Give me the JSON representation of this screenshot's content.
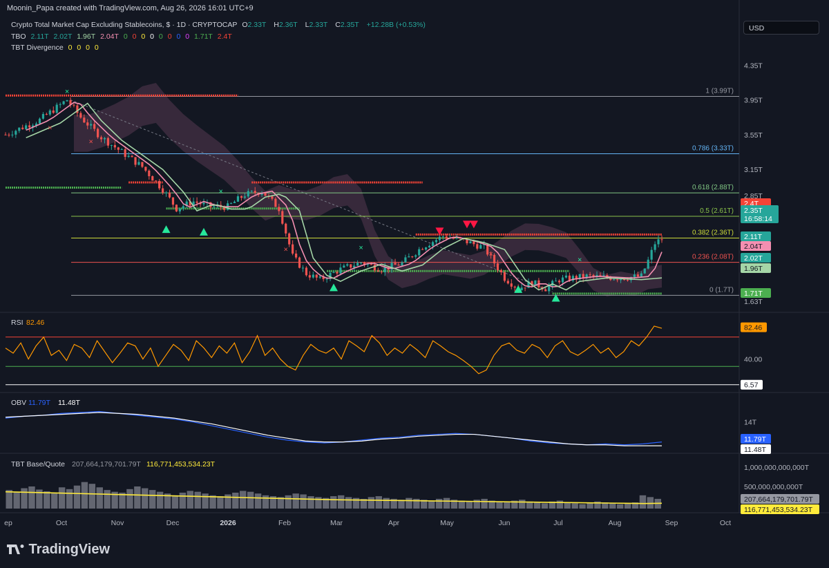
{
  "header": {
    "credit": "Moonin_Papa created with TradingView.com, Aug 26, 2026 16:01 UTC+9"
  },
  "symbol": {
    "title": "Crypto Total Market Cap Excluding Stablecoins, $ · 1D · CRYPTOCAP",
    "o_label": "O",
    "o": "2.33T",
    "h_label": "H",
    "h": "2.36T",
    "l_label": "L",
    "l": "2.33T",
    "c_label": "C",
    "c": "2.35T",
    "change": "+12.28B (+0.53%)"
  },
  "tbo_legend": {
    "label": "TBO",
    "values": [
      "2.11T",
      "2.02T",
      "1.96T",
      "2.04T",
      "0",
      "0",
      "0",
      "0",
      "0",
      "0",
      "0",
      "0",
      "1.71T",
      "2.4T"
    ]
  },
  "div_legend": {
    "label": "TBT Divergence",
    "values": [
      "0",
      "0",
      "0",
      "0"
    ]
  },
  "currency": "USD",
  "colors": {
    "bg": "#131722",
    "up": "#26a69a",
    "down": "#ef5350",
    "pink": "#f48fb1",
    "mint": "#a5d6a7",
    "rsi": "#ff9800",
    "obv": "#2962ff",
    "yellow": "#ffeb3b",
    "green_level": "#4caf50",
    "red_level": "#f44336"
  },
  "chart_data": [
    {
      "type": "candlestick",
      "title": "Crypto Total Market Cap Excluding Stablecoins",
      "x_ticks": [
        "ep",
        "Oct",
        "Nov",
        "Dec",
        "2026",
        "Feb",
        "Mar",
        "Apr",
        "May",
        "Jun",
        "Jul",
        "Aug",
        "Sep",
        "Oct"
      ],
      "y_ticks": [
        "4.35T",
        "3.95T",
        "3.55T",
        "3.15T",
        "2.85T",
        "2.65T",
        "1.75T",
        "1.63T"
      ],
      "ylim": [
        1.6,
        4.4
      ],
      "series_path": [
        [
          0,
          3.55
        ],
        [
          10,
          3.72
        ],
        [
          18,
          3.95
        ],
        [
          22,
          3.75
        ],
        [
          28,
          3.52
        ],
        [
          34,
          3.35
        ],
        [
          40,
          3.18
        ],
        [
          46,
          2.92
        ],
        [
          50,
          2.7
        ],
        [
          55,
          2.78
        ],
        [
          60,
          2.72
        ],
        [
          65,
          2.72
        ],
        [
          70,
          2.86
        ],
        [
          75,
          2.9
        ],
        [
          80,
          2.7
        ],
        [
          84,
          2.15
        ],
        [
          88,
          1.95
        ],
        [
          92,
          1.88
        ],
        [
          98,
          2.0
        ],
        [
          104,
          2.08
        ],
        [
          110,
          2.0
        ],
        [
          116,
          2.07
        ],
        [
          122,
          2.26
        ],
        [
          128,
          2.38
        ],
        [
          134,
          2.33
        ],
        [
          140,
          2.25
        ],
        [
          146,
          1.9
        ],
        [
          150,
          1.78
        ],
        [
          154,
          1.85
        ],
        [
          158,
          1.78
        ],
        [
          162,
          1.88
        ],
        [
          170,
          1.92
        ],
        [
          180,
          1.9
        ],
        [
          186,
          1.92
        ],
        [
          188,
          2.1
        ],
        [
          190,
          2.3
        ],
        [
          192,
          2.35
        ]
      ],
      "fib_levels": [
        {
          "label": "1 (3.99T)",
          "value": 3.99,
          "color": "#9598a1"
        },
        {
          "label": "0.786 (3.33T)",
          "value": 3.33,
          "color": "#64b5f6"
        },
        {
          "label": "0.618 (2.88T)",
          "value": 2.88,
          "color": "#81c784"
        },
        {
          "label": "0.5 (2.61T)",
          "value": 2.61,
          "color": "#8bc34a"
        },
        {
          "label": "0.382 (2.36T)",
          "value": 2.36,
          "color": "#cddc39"
        },
        {
          "label": "0.236 (2.08T)",
          "value": 2.08,
          "color": "#ef5350"
        },
        {
          "label": "0 (1.7T)",
          "value": 1.7,
          "color": "#9598a1"
        }
      ],
      "support_levels": [
        {
          "value": 2.94,
          "from": 0,
          "to": 34,
          "color": "#4caf50"
        },
        {
          "value": 2.7,
          "from": 47,
          "to": 86,
          "color": "#4caf50"
        },
        {
          "value": 1.98,
          "from": 94,
          "to": 165,
          "color": "#4caf50"
        },
        {
          "value": 1.72,
          "from": 160,
          "to": 192,
          "color": "#4caf50"
        }
      ],
      "resistance_levels": [
        {
          "value": 4.0,
          "from": 0,
          "to": 68,
          "color": "#f44336"
        },
        {
          "value": 3.0,
          "from": 36,
          "to": 46,
          "color": "#f44336"
        },
        {
          "value": 3.0,
          "from": 72,
          "to": 122,
          "color": "#f44336"
        },
        {
          "value": 2.4,
          "from": 120,
          "to": 192,
          "color": "#f44336"
        }
      ],
      "price_labels": [
        {
          "text": "2.4T",
          "value": 2.4,
          "color": "#f44336"
        },
        {
          "text": "2.35T",
          "sub": "16:58:14",
          "value": 2.35,
          "color": "#26a69a"
        },
        {
          "text": "2.11T",
          "value": 2.11,
          "color": "#26a69a"
        },
        {
          "text": "2.04T",
          "value": 2.04,
          "color": "#f48fb1"
        },
        {
          "text": "2.02T",
          "value": 2.02,
          "color": "#26a69a"
        },
        {
          "text": "1.96T",
          "value": 1.96,
          "color": "#a5d6a7"
        },
        {
          "text": "1.71T",
          "value": 1.71,
          "color": "#4caf50"
        }
      ]
    },
    {
      "type": "line",
      "title": "RSI",
      "value": "82.46",
      "y_ticks": [
        "40.00"
      ],
      "ylim": [
        0,
        100
      ],
      "bands": [
        70,
        30
      ],
      "min_label": "6.57",
      "values": [
        55,
        48,
        62,
        40,
        58,
        70,
        45,
        52,
        38,
        60,
        55,
        42,
        65,
        50,
        35,
        48,
        62,
        58,
        40,
        55,
        30,
        45,
        60,
        52,
        38,
        65,
        55,
        42,
        58,
        48,
        62,
        35,
        50,
        72,
        45,
        55,
        40,
        30,
        25,
        45,
        60,
        52,
        48,
        55,
        40,
        65,
        58,
        50,
        72,
        62,
        45,
        55,
        48,
        60,
        52,
        42,
        65,
        58,
        50,
        45,
        38,
        30,
        20,
        25,
        45,
        58,
        62,
        52,
        48,
        60,
        55,
        42,
        58,
        65,
        50,
        45,
        52,
        60,
        48,
        55,
        42,
        50,
        65,
        58,
        70,
        85,
        82
      ]
    },
    {
      "type": "line",
      "title": "OBV",
      "values_labels": [
        "11.79T",
        "11.48T"
      ],
      "y_ticks": [
        "14T"
      ],
      "series": [
        {
          "name": "OBV",
          "color": "#2962ff",
          "values": [
            14.4,
            14.6,
            14.7,
            14.9,
            15.0,
            15.1,
            14.9,
            14.7,
            14.5,
            14.3,
            14.0,
            13.6,
            13.2,
            12.8,
            12.4,
            12.1,
            11.9,
            11.8,
            11.9,
            12.1,
            12.3,
            12.4,
            12.6,
            12.7,
            12.8,
            12.7,
            12.5,
            12.3,
            12.0,
            11.8,
            11.7,
            11.6,
            11.7,
            11.6,
            11.7,
            11.9
          ]
        },
        {
          "name": "Signal",
          "color": "#ffffff",
          "values": [
            14.5,
            14.6,
            14.7,
            14.8,
            14.9,
            15.0,
            14.9,
            14.8,
            14.6,
            14.4,
            14.1,
            13.8,
            13.4,
            13.0,
            12.6,
            12.3,
            12.0,
            11.9,
            11.9,
            12.0,
            12.2,
            12.3,
            12.5,
            12.6,
            12.7,
            12.7,
            12.5,
            12.3,
            12.1,
            11.9,
            11.7,
            11.6,
            11.6,
            11.5,
            11.5,
            11.5
          ]
        }
      ]
    },
    {
      "type": "bar",
      "title": "TBT Base/Quote",
      "values_labels": [
        "207,664,179,701.79T",
        "116,771,453,534.23T"
      ],
      "y_ticks": [
        "1,000,000,000,000T",
        "500,000,000,000T"
      ],
      "values": [
        420,
        380,
        460,
        500,
        430,
        390,
        350,
        480,
        440,
        520,
        600,
        560,
        480,
        420,
        380,
        360,
        440,
        500,
        460,
        420,
        380,
        340,
        300,
        360,
        400,
        380,
        340,
        300,
        280,
        320,
        360,
        400,
        380,
        340,
        300,
        280,
        260,
        300,
        340,
        320,
        280,
        260,
        240,
        280,
        300,
        260,
        240,
        220,
        260,
        280,
        240,
        220,
        200,
        240,
        220,
        200,
        180,
        220,
        240,
        200,
        180,
        160,
        200,
        220,
        180,
        160,
        140,
        180,
        200,
        160,
        140,
        120,
        160,
        180,
        140,
        120,
        100,
        140,
        160,
        140,
        120,
        100,
        120,
        140,
        300,
        260,
        220
      ],
      "signal": [
        380,
        370,
        360,
        350,
        340,
        330,
        320,
        310,
        300,
        290,
        280,
        270,
        260,
        250,
        240,
        230,
        220,
        210,
        200,
        195,
        190,
        185,
        180,
        175,
        170,
        165,
        160,
        155,
        150,
        145,
        140,
        135,
        130,
        125,
        120,
        115,
        120
      ]
    }
  ]
}
